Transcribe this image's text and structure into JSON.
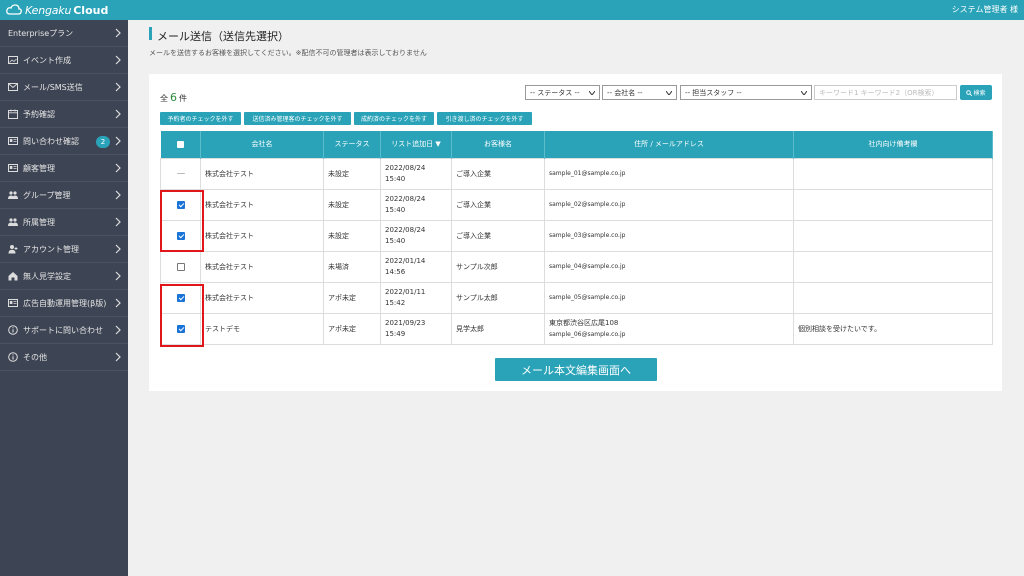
{
  "app": {
    "logo_prefix": "Kengaku",
    "logo_suffix": "Cloud",
    "user": "システム管理者 様"
  },
  "sidebar": {
    "items": [
      {
        "label": "Enterpriseプラン",
        "icon": "none"
      },
      {
        "label": "イベント作成",
        "icon": "image-icon"
      },
      {
        "label": "メール/SMS送信",
        "icon": "mail-icon"
      },
      {
        "label": "予約確認",
        "icon": "calendar-icon"
      },
      {
        "label": "問い合わせ確認",
        "icon": "card-icon",
        "badge": "2"
      },
      {
        "label": "顧客管理",
        "icon": "card-icon"
      },
      {
        "label": "グループ管理",
        "icon": "users-icon"
      },
      {
        "label": "所属管理",
        "icon": "users-icon"
      },
      {
        "label": "アカウント管理",
        "icon": "user-icon"
      },
      {
        "label": "無人見学設定",
        "icon": "home-icon"
      },
      {
        "label": "広告自動運用管理(β版)",
        "icon": "card-icon"
      },
      {
        "label": "サポートに問い合わせ",
        "icon": "info-icon"
      },
      {
        "label": "その他",
        "icon": "info-icon"
      }
    ]
  },
  "page": {
    "title": "メール送信（送信先選択）",
    "subtitle": "メールを送信するお客様を選択してください。※配信不可の管理者は表示しておりません"
  },
  "count": {
    "prefix": "全",
    "value": "6",
    "suffix": "件"
  },
  "filters": {
    "status": "-- ステータス --",
    "company": "-- 会社名 --",
    "staff": "-- 担当スタッフ --",
    "keyword_placeholder": "キーワード1 キーワード2（OR検索）",
    "search_label": "検索"
  },
  "check_buttons": [
    "予約者のチェックを外す",
    "送信済み管理客のチェックを外す",
    "成約済のチェックを外す",
    "引き渡し済のチェックを外す"
  ],
  "table": {
    "headers": [
      "",
      "会社名",
      "ステータス",
      "リスト追加日 ▼",
      "お客様名",
      "住所 / メールアドレス",
      "社内向け備考欄"
    ],
    "rows": [
      {
        "checked": "disabled",
        "company": "株式会社テスト",
        "status": "未設定",
        "date": "2022/08/24",
        "time": "15:40",
        "customer": "ご導入企業",
        "address": "",
        "email": "sample_01@sample.co.jp",
        "note": ""
      },
      {
        "checked": "on",
        "company": "株式会社テスト",
        "status": "未設定",
        "date": "2022/08/24",
        "time": "15:40",
        "customer": "ご導入企業",
        "address": "",
        "email": "sample_02@sample.co.jp",
        "note": ""
      },
      {
        "checked": "on",
        "company": "株式会社テスト",
        "status": "未設定",
        "date": "2022/08/24",
        "time": "15:40",
        "customer": "ご導入企業",
        "address": "",
        "email": "sample_03@sample.co.jp",
        "note": ""
      },
      {
        "checked": "off",
        "company": "株式会社テスト",
        "status": "未場済",
        "date": "2022/01/14",
        "time": "14:56",
        "customer": "サンプル次郎",
        "address": "",
        "email": "sample_04@sample.co.jp",
        "note": ""
      },
      {
        "checked": "on",
        "company": "株式会社テスト",
        "status": "アポ未定",
        "date": "2022/01/11",
        "time": "15:42",
        "customer": "サンプル太郎",
        "address": "",
        "email": "sample_05@sample.co.jp",
        "note": ""
      },
      {
        "checked": "on",
        "company": "テストデモ",
        "status": "アポ未定",
        "date": "2021/09/23",
        "time": "15:49",
        "customer": "見学太郎",
        "address": "東京都渋谷区広尾108",
        "email": "sample_06@sample.co.jp",
        "note": "個別相談を受けたいです。"
      }
    ]
  },
  "main_button": "メール本文編集画面へ",
  "colors": {
    "accent": "#2aa3b9",
    "sidebar": "#3d4453",
    "highlight": "#e0161a",
    "check": "#1a73d6"
  }
}
